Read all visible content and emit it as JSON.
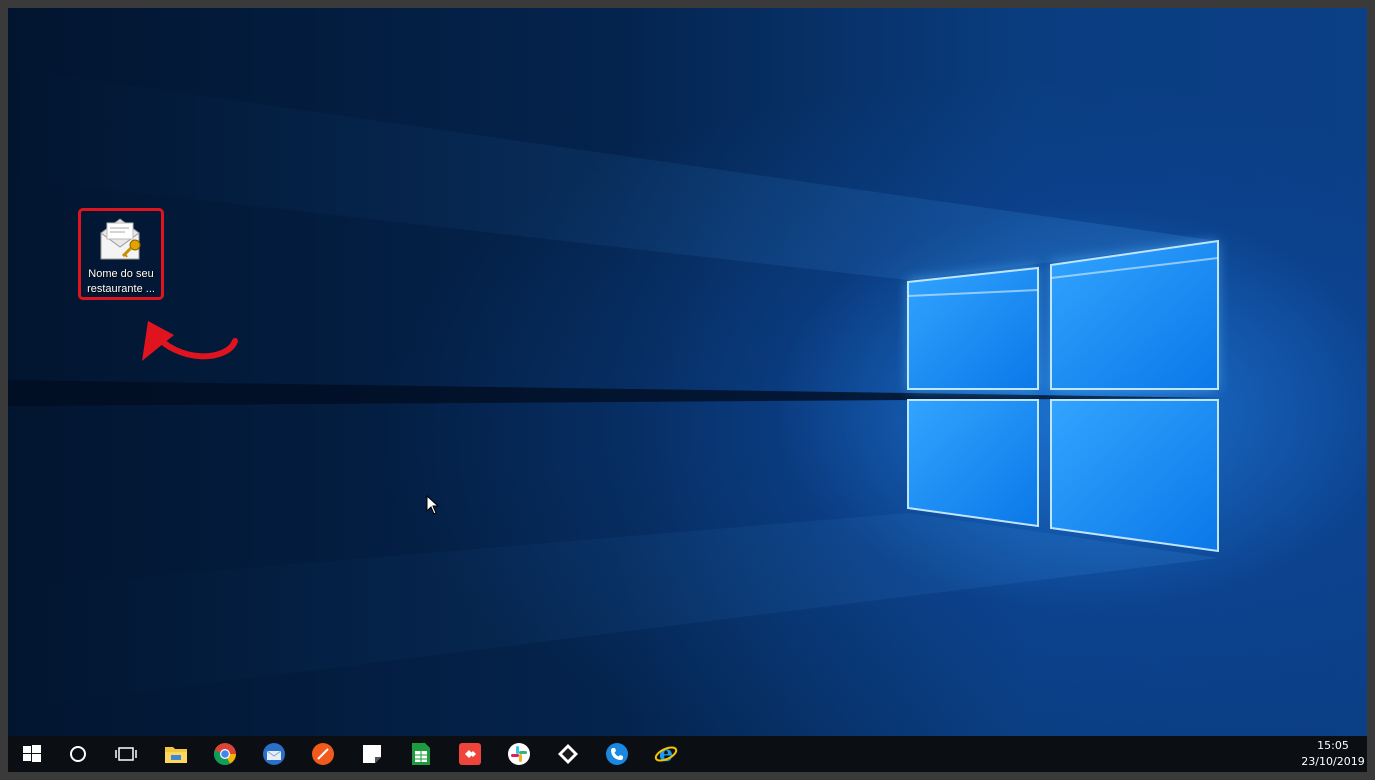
{
  "desktop": {
    "icons": [
      {
        "label_line1": "Nome do seu",
        "label_line2": "restaurante ...",
        "icon": "mail-key-icon"
      }
    ],
    "annotation": {
      "highlight_color": "#e0141e",
      "arrow": "curved-arrow-icon"
    }
  },
  "taskbar": {
    "apps": [
      {
        "name": "start",
        "icon": "windows-logo-icon"
      },
      {
        "name": "cortana",
        "icon": "search-circle-icon"
      },
      {
        "name": "task-view",
        "icon": "task-view-icon"
      },
      {
        "name": "file-explorer",
        "icon": "folder-icon"
      },
      {
        "name": "chrome",
        "icon": "chrome-icon"
      },
      {
        "name": "thunderbird",
        "icon": "thunderbird-icon"
      },
      {
        "name": "orange-app",
        "icon": "feather-icon"
      },
      {
        "name": "sticky-notes",
        "icon": "sticky-note-icon"
      },
      {
        "name": "spreadsheet",
        "icon": "spreadsheet-icon"
      },
      {
        "name": "anydesk",
        "icon": "anydesk-icon"
      },
      {
        "name": "slack",
        "icon": "slack-icon"
      },
      {
        "name": "inkscape",
        "icon": "inkscape-icon"
      },
      {
        "name": "phone-app",
        "icon": "phone-icon"
      },
      {
        "name": "internet-explorer",
        "icon": "ie-icon"
      }
    ],
    "clock": {
      "time": "15:05",
      "date": "23/10/2019"
    }
  },
  "colors": {
    "accent": "#1e8fff",
    "taskbar": "#0b0f14",
    "highlight": "#e0141e"
  }
}
